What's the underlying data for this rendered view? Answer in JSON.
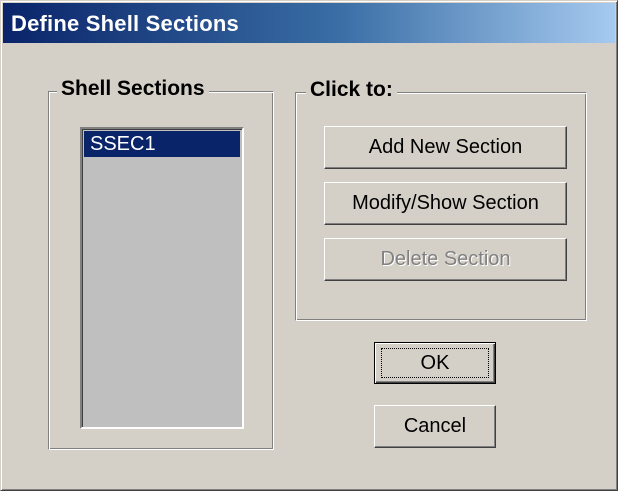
{
  "window": {
    "title": "Define Shell Sections"
  },
  "shell_sections": {
    "label": "Shell Sections",
    "items": [
      "SSEC1"
    ],
    "selected": "SSEC1"
  },
  "click_to": {
    "label": "Click to:",
    "add_new_section": "Add New Section",
    "modify_show_section": "Modify/Show Section",
    "delete_section": "Delete Section"
  },
  "buttons": {
    "ok": "OK",
    "cancel": "Cancel"
  },
  "colors": {
    "title_gradient_start": "#0a246a",
    "title_gradient_end": "#a6caf0",
    "dialog_face": "#d4d0c8",
    "selection": "#0a246a",
    "list_background": "#bfbfbf"
  }
}
